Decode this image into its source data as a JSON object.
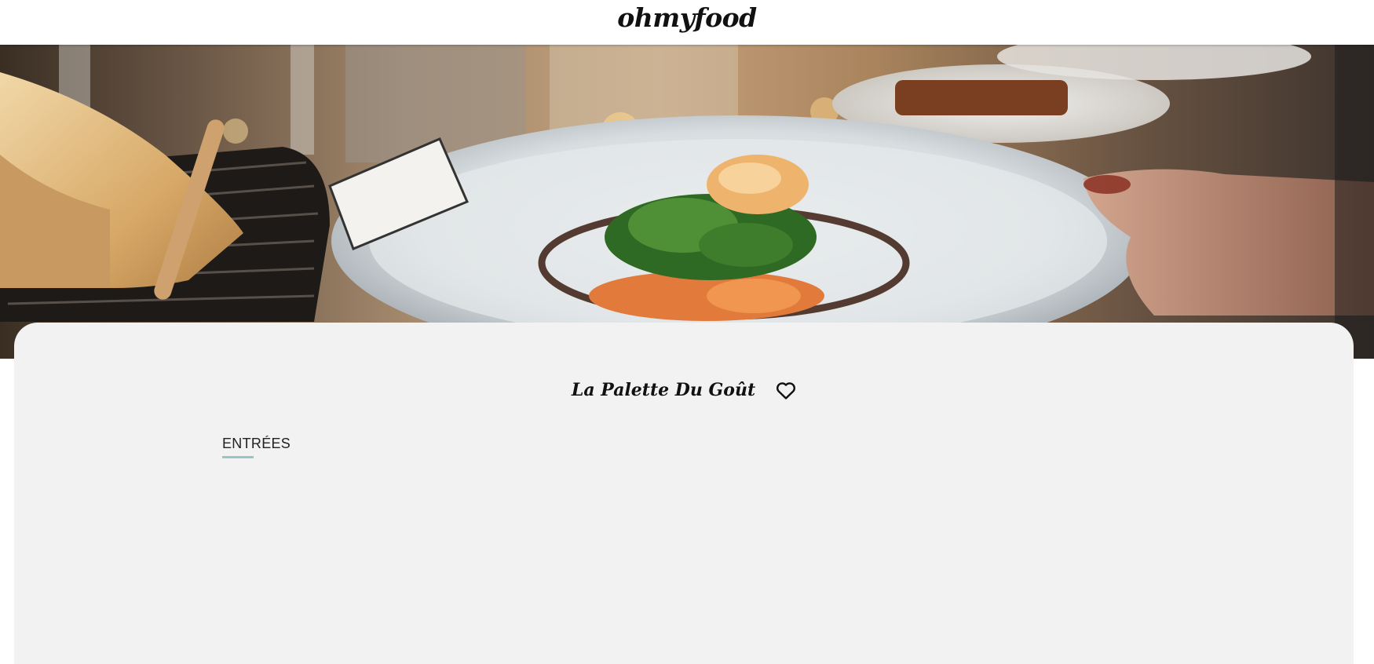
{
  "header": {
    "logo_text": "ohmyfood"
  },
  "hero": {
    "image_icon": "plated-dish-photo"
  },
  "restaurant": {
    "name": "La Palette Du Goût",
    "favorite_icon": "heart-outline-icon"
  },
  "menu": {
    "section_title": "ENTRÉES",
    "accent_color": "#99c5c5",
    "dishes": [
      {
        "name": "",
        "description": "",
        "price": ""
      },
      {
        "name": "",
        "description": "",
        "price": ""
      },
      {
        "name": "",
        "description": "",
        "price": ""
      }
    ]
  }
}
